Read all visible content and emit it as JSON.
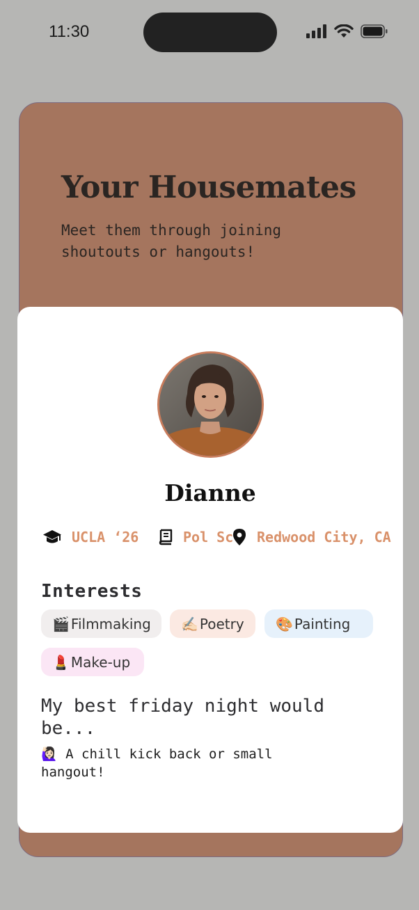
{
  "status_bar": {
    "time": "11:30",
    "icons": [
      "cellular-signal-icon",
      "wifi-icon",
      "battery-icon"
    ]
  },
  "header": {
    "title": "Your Housemates",
    "subtitle": "Meet them through joining shoutouts or hangouts!"
  },
  "profile": {
    "name": "Dianne",
    "meta": [
      {
        "icon": "graduation-cap-icon",
        "text": "UCLA ‘26"
      },
      {
        "icon": "book-icon",
        "text": "Pol Sci"
      },
      {
        "icon": "location-pin-icon",
        "text": "Redwood City, CA"
      }
    ],
    "interests_heading": "Interests",
    "interests": [
      {
        "emoji": "🎬",
        "label": "Filmmaking",
        "color": "#f1eeee"
      },
      {
        "emoji": "✍🏻",
        "label": "Poetry",
        "color": "#fbe9e2"
      },
      {
        "emoji": "🎨",
        "label": "Painting",
        "color": "#e6f1fb"
      },
      {
        "emoji": "💄",
        "label": "Make-up",
        "color": "#fbe6f5"
      }
    ],
    "prompt": {
      "question": "My best friday night would be...",
      "answer_emoji": "🙋🏻‍♀️",
      "answer": "A chill kick back or small hangout!"
    }
  },
  "colors": {
    "background": "#b6b6b4",
    "header_card": "#a5755e",
    "accent_text": "#d9916a",
    "avatar_border": "#c87c5c"
  }
}
